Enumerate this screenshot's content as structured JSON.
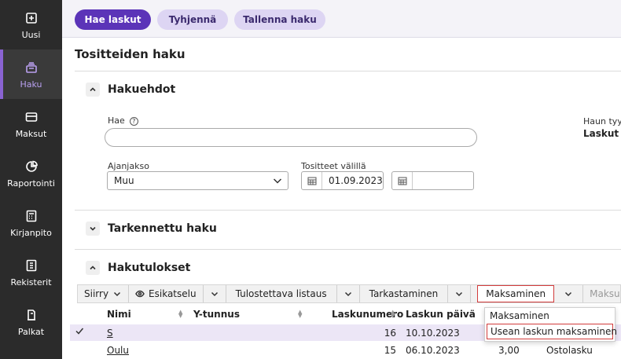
{
  "sidebar": {
    "items": [
      {
        "label": "Uusi",
        "icon": "plus-square-icon"
      },
      {
        "label": "Haku",
        "icon": "stack-icon",
        "active": true
      },
      {
        "label": "Maksut",
        "icon": "card-icon"
      },
      {
        "label": "Raportointi",
        "icon": "pie-chart-icon"
      },
      {
        "label": "Kirjanpito",
        "icon": "calculator-icon"
      },
      {
        "label": "Rekisterit",
        "icon": "register-icon"
      },
      {
        "label": "Palkat",
        "icon": "salary-icon"
      }
    ]
  },
  "toolbar": {
    "search_label": "Hae laskut",
    "clear_label": "Tyhjennä",
    "save_label": "Tallenna haku"
  },
  "page": {
    "title": "Tositteiden haku"
  },
  "criteria": {
    "section_title": "Hakuehdot",
    "search_label": "Hae",
    "search_value": "",
    "period_label": "Ajanjakso",
    "period_value": "Muu",
    "date_range_label": "Tositteet välillä",
    "date_from": "01.09.2023",
    "date_to": "",
    "search_type_label": "Haun tyyppi",
    "search_type_value": "Laskut"
  },
  "advanced": {
    "section_title": "Tarkennettu haku"
  },
  "results": {
    "section_title": "Hakutulokset",
    "toolbar": {
      "move": "Siirry",
      "preview": "Esikatselu",
      "print_list": "Tulostettava listaus",
      "inspect": "Tarkastaminen",
      "payment": "Maksaminen",
      "payment_disabled": "Maksu"
    },
    "columns": {
      "name": "Nimi",
      "ytunnus": "Y-tunnus",
      "number": "Laskunumero",
      "date": "Laskun päivä"
    },
    "rows": [
      {
        "name": "S",
        "ytunnus": "",
        "number": "16",
        "date": "10.10.2023",
        "amount": "",
        "type": ""
      },
      {
        "name": "Oulu",
        "ytunnus": "",
        "number": "15",
        "date": "06.10.2023",
        "amount": "3,00",
        "type": "Ostolasku"
      }
    ]
  },
  "dropdown": {
    "items": [
      "Maksaminen",
      "Usean laskun maksaminen"
    ]
  },
  "colors": {
    "accent": "#5b34b8",
    "accent_light": "#ddd5f3",
    "sidebar_bg": "#2b2b2b",
    "highlight_outline": "#d23b3b"
  }
}
